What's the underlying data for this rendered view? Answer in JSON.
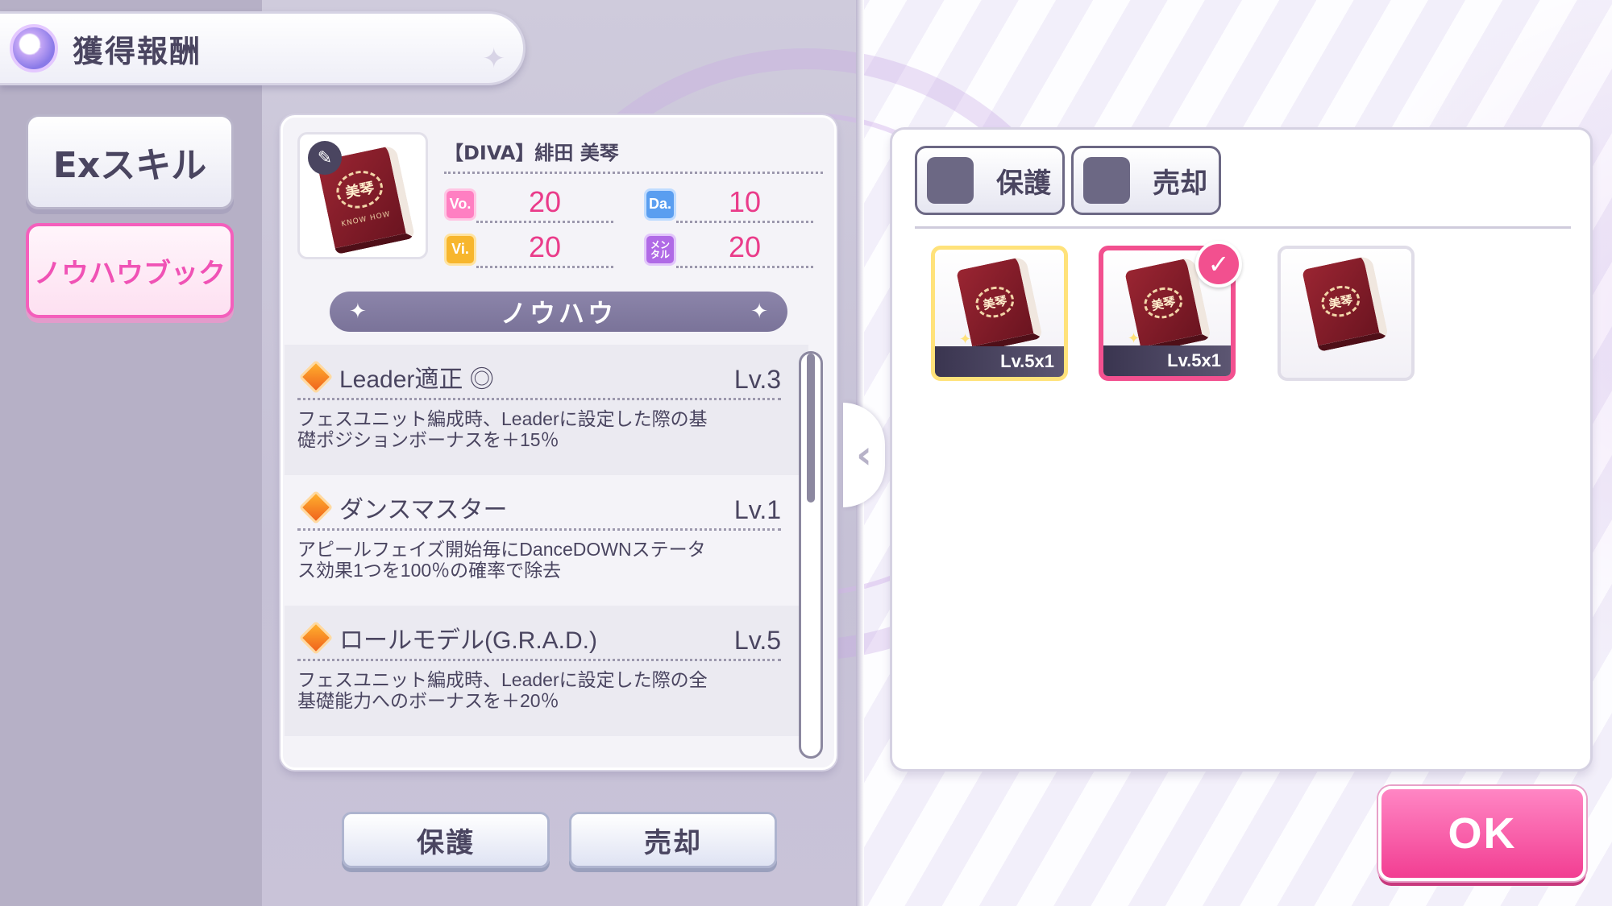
{
  "header": {
    "title": "獲得報酬"
  },
  "side_tabs": [
    {
      "label": "Exスキル",
      "active": false
    },
    {
      "label": "ノウハウブック",
      "active": true
    }
  ],
  "detail": {
    "item_name": "【DIVA】緋田 美琴",
    "book_emblem": "美琴",
    "book_subtitle": "KNOW HOW",
    "stats": [
      {
        "badge": "Vo.",
        "value": "20",
        "color": "#ff7fc2"
      },
      {
        "badge": "Da.",
        "value": "10",
        "color": "#5a9ef0"
      },
      {
        "badge": "Vi.",
        "value": "20",
        "color": "#f7b62d"
      },
      {
        "badge": "メンタル",
        "value": "20",
        "color": "#b06ae6"
      }
    ],
    "section_title": "ノウハウ",
    "skills": [
      {
        "name": "Leader適正 ◎",
        "level": "Lv.3",
        "desc": "フェスユニット編成時、Leaderに設定した際の基礎ポジションボーナスを＋15％"
      },
      {
        "name": "ダンスマスター",
        "level": "Lv.1",
        "desc": "アピールフェイズ開始毎にDanceDOWNステータス効果1つを100％の確率で除去"
      },
      {
        "name": "ロールモデル(G.R.A.D.)",
        "level": "Lv.5",
        "desc": "フェスユニット編成時、Leaderに設定した際の全基礎能力へのボーナスを＋20％"
      }
    ]
  },
  "buttons": {
    "protect": "保護",
    "sell": "売却",
    "ok": "OK"
  },
  "filters": {
    "protect": "保護",
    "sell": "売却"
  },
  "cards": [
    {
      "level": "Lv.5x1",
      "selected": false
    },
    {
      "level": "Lv.5x1",
      "selected": true
    },
    {
      "level": "",
      "selected": false
    }
  ],
  "icons": {
    "header": "reward-medal-icon",
    "edit": "pen-icon",
    "skill": "diamond-arrow-icon",
    "collapse": "chevron-left-icon",
    "selected": "check-icon"
  },
  "colors": {
    "accent_pink": "#f23e92",
    "text": "#4a4560",
    "stat_value": "#ea3b8a"
  }
}
